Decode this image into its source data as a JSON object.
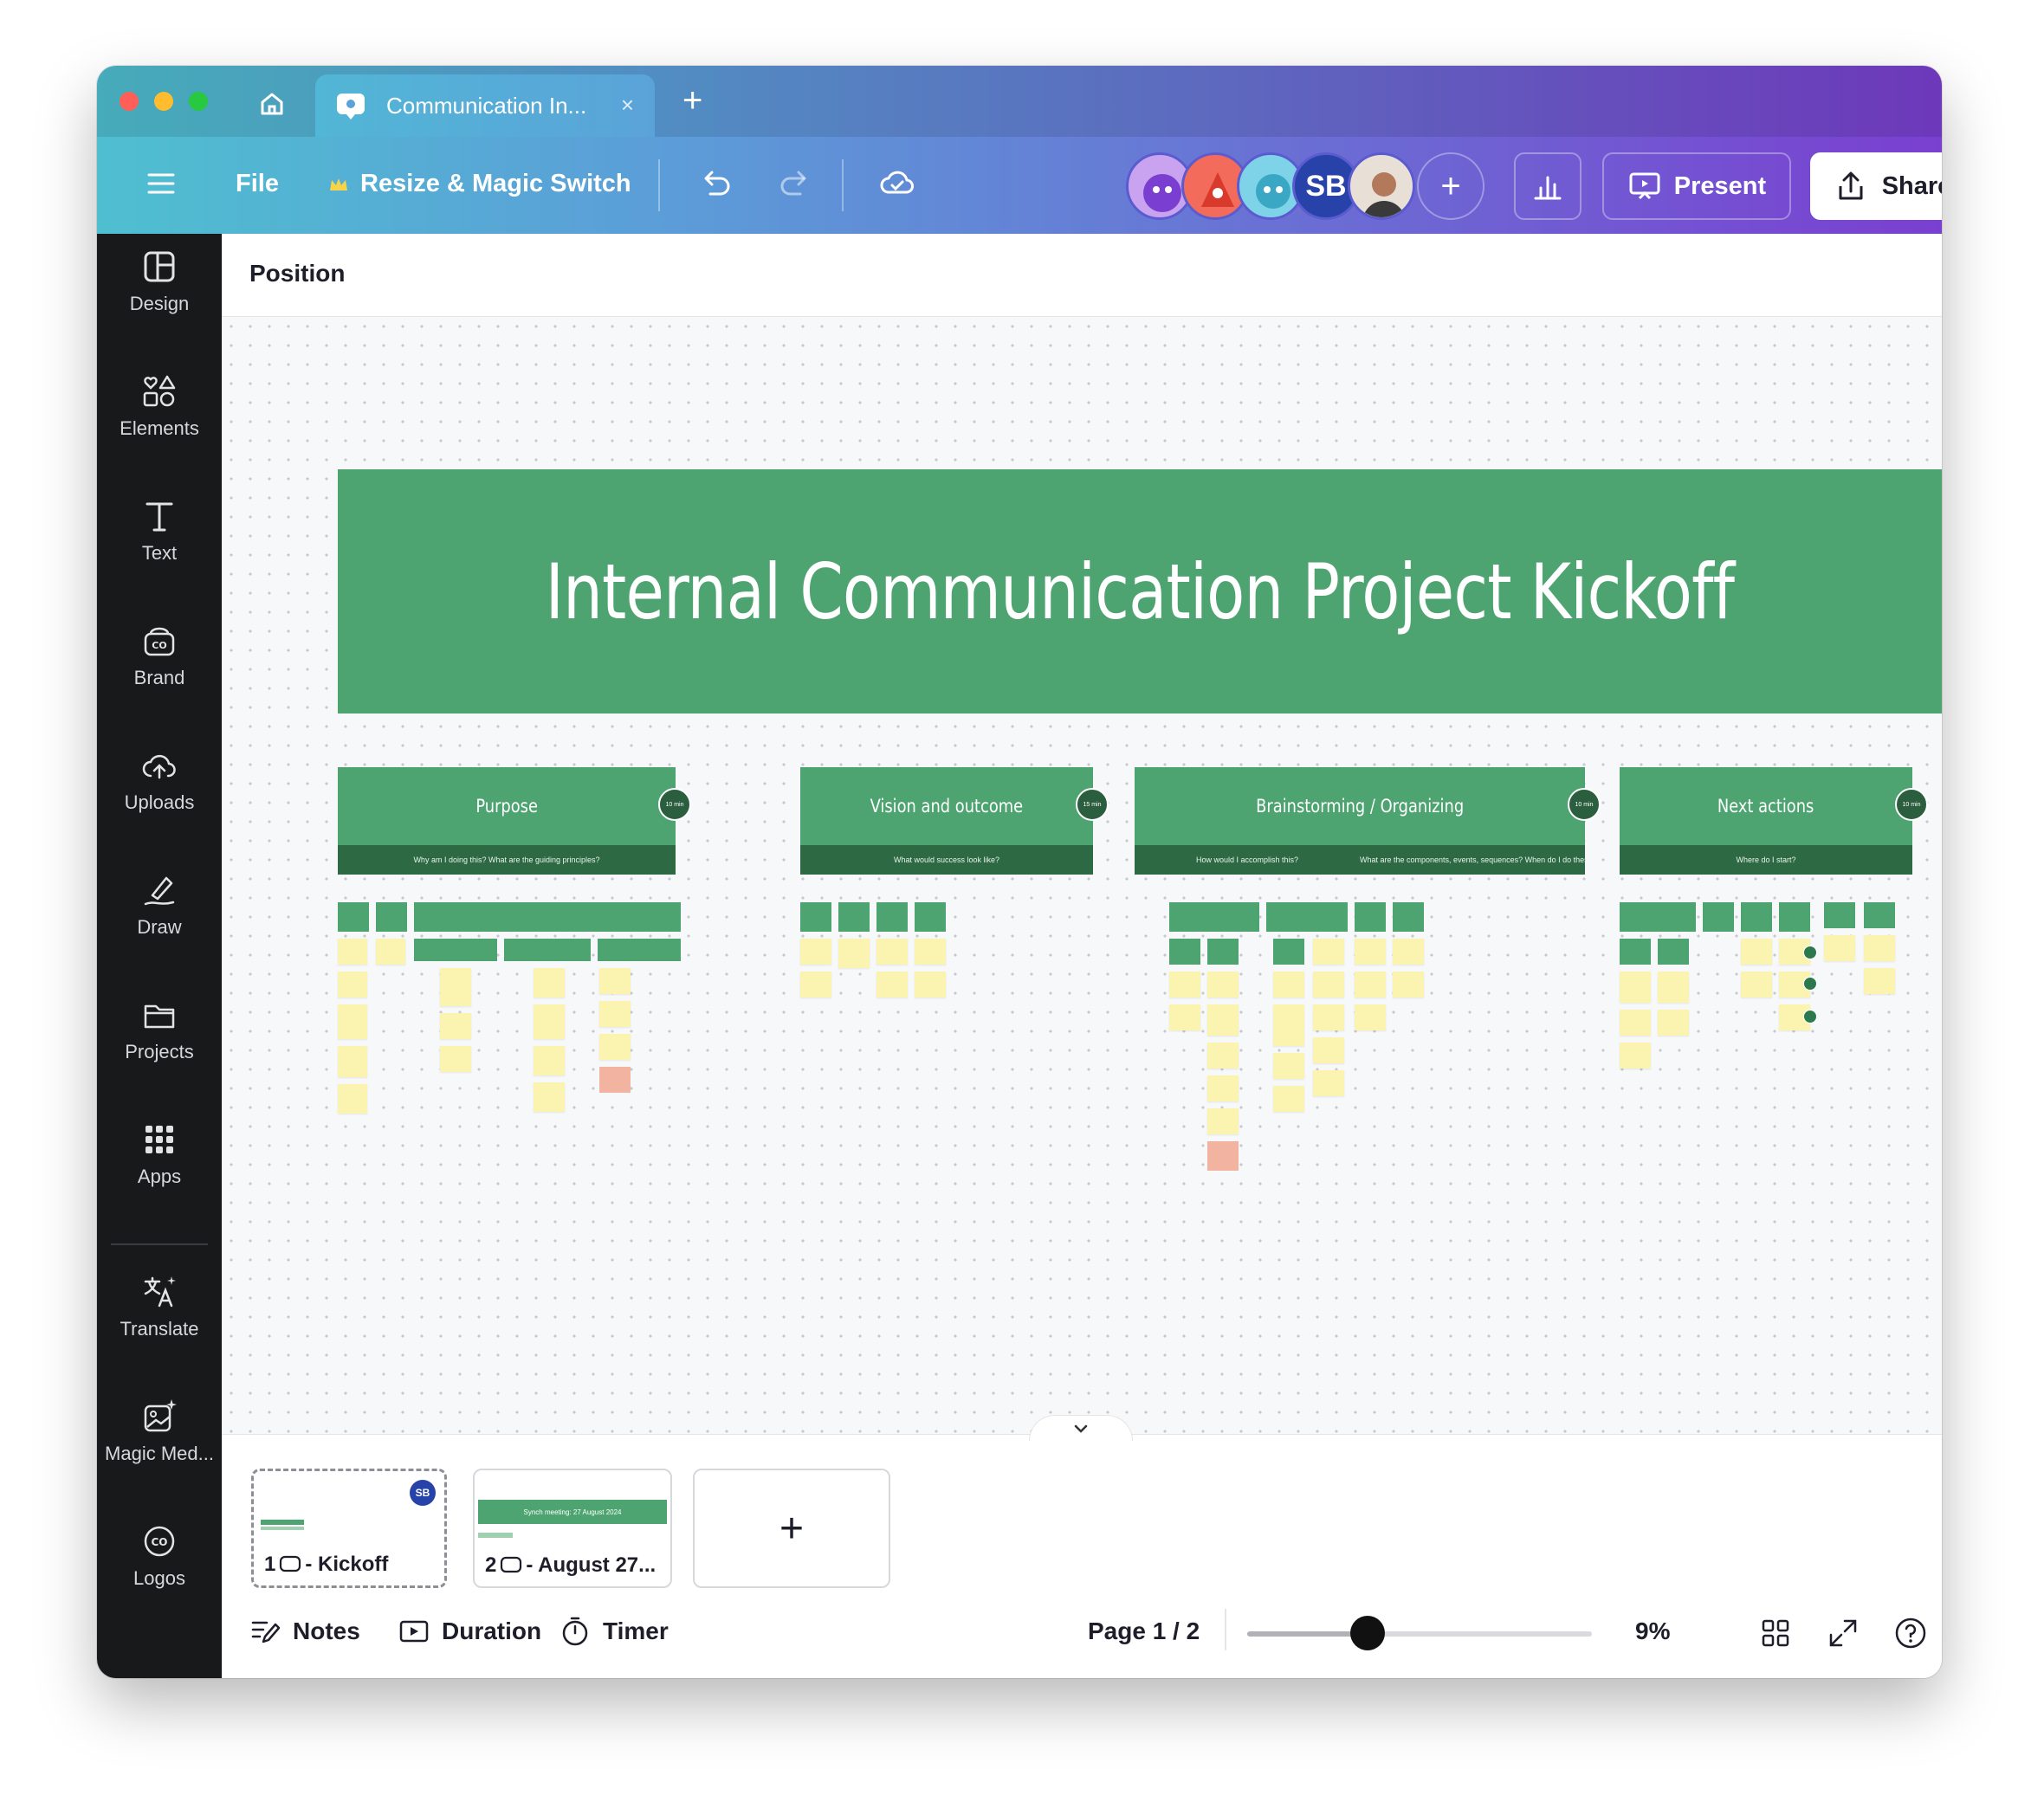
{
  "browser": {
    "tab_title": "Communication In...",
    "tab_close": "×",
    "new_tab": "+"
  },
  "toolbar": {
    "file_label": "File",
    "resize_label": "Resize & Magic Switch",
    "collaborators": [
      "SB"
    ],
    "add_collaborator": "+",
    "present_label": "Present",
    "share_label": "Share"
  },
  "sidebar": {
    "items": [
      {
        "label": "Design",
        "icon": "layout-icon"
      },
      {
        "label": "Elements",
        "icon": "shapes-icon"
      },
      {
        "label": "Text",
        "icon": "text-icon"
      },
      {
        "label": "Brand",
        "icon": "brand-icon"
      },
      {
        "label": "Uploads",
        "icon": "cloud-upload-icon"
      },
      {
        "label": "Draw",
        "icon": "pen-icon"
      },
      {
        "label": "Projects",
        "icon": "folder-icon"
      },
      {
        "label": "Apps",
        "icon": "grid-icon"
      },
      {
        "label": "Translate",
        "icon": "translate-icon"
      },
      {
        "label": "Magic Med...",
        "icon": "magic-media-icon"
      },
      {
        "label": "Logos",
        "icon": "logo-icon"
      }
    ]
  },
  "context_bar": {
    "position_label": "Position"
  },
  "board": {
    "title": "Internal Communication Project Kickoff",
    "sections": [
      {
        "title": "Purpose",
        "time": "10 min",
        "subtitle": [
          "Why am I doing this? What are the guiding principles?"
        ]
      },
      {
        "title": "Vision and outcome",
        "time": "15 min",
        "subtitle": [
          "What would success look like?"
        ]
      },
      {
        "title": "Brainstorming / Organizing",
        "time": "10 min",
        "subtitle": [
          "How would I accomplish this?",
          "What are the components, events, sequences? When do I do these things?"
        ]
      },
      {
        "title": "Next actions",
        "time": "10 min",
        "subtitle": [
          "Where do I start?"
        ]
      }
    ]
  },
  "pages": {
    "items": [
      {
        "number": "1",
        "label": "- Kickoff",
        "badge": "SB"
      },
      {
        "number": "2",
        "label": "- August 27...",
        "banner": "Synch meeting: 27 August 2024"
      }
    ],
    "add_label": "+",
    "collapse": "⌄"
  },
  "bottombar": {
    "notes_label": "Notes",
    "duration_label": "Duration",
    "timer_label": "Timer",
    "page_indicator": "Page 1 / 2",
    "zoom": "9%",
    "zoom_fraction": 0.35
  },
  "colors": {
    "board_green": "#4ea470",
    "board_dark_green": "#2d6a44",
    "sticky_yellow": "#fbf4b0",
    "sticky_pink": "#f2b3a0",
    "share_button": "#ffffff"
  }
}
